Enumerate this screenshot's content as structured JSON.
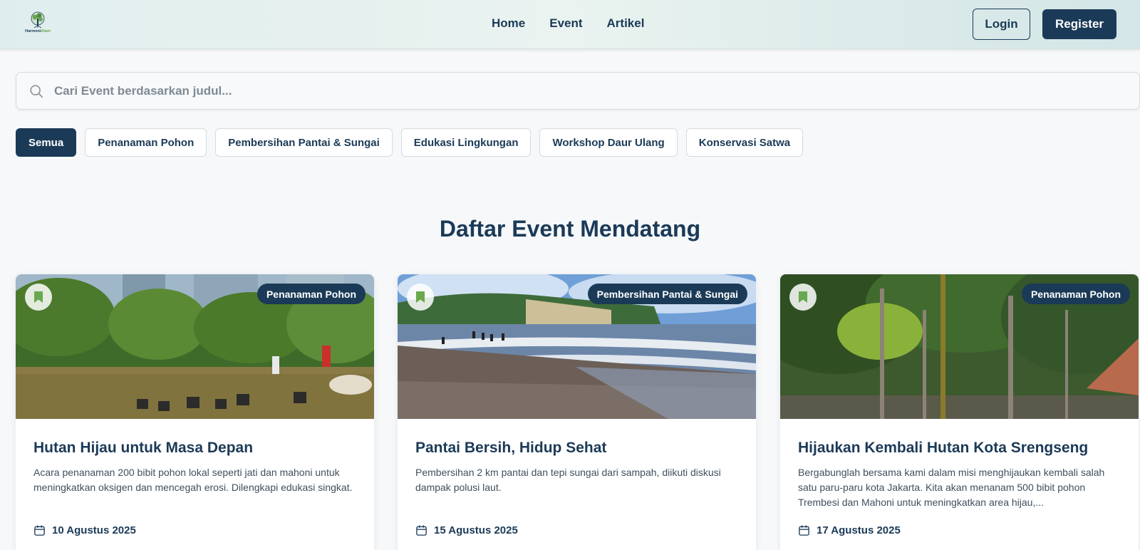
{
  "header": {
    "logo_text_main": "Harmoni",
    "logo_text_accent": "Alam",
    "nav": [
      "Home",
      "Event",
      "Artikel"
    ],
    "login_label": "Login",
    "register_label": "Register"
  },
  "search": {
    "placeholder": "Cari Event berdasarkan judul..."
  },
  "filters": [
    {
      "label": "Semua",
      "active": true
    },
    {
      "label": "Penanaman Pohon",
      "active": false
    },
    {
      "label": "Pembersihan Pantai & Sungai",
      "active": false
    },
    {
      "label": "Edukasi Lingkungan",
      "active": false
    },
    {
      "label": "Workshop Daur Ulang",
      "active": false
    },
    {
      "label": "Konservasi Satwa",
      "active": false
    }
  ],
  "section_title": "Daftar Event Mendatang",
  "events": [
    {
      "category": "Penanaman Pohon",
      "title": "Hutan Hijau untuk Masa Depan",
      "description": "Acara penanaman 200 bibit pohon lokal seperti jati dan mahoni untuk meningkatkan oksigen dan mencegah erosi. Dilengkapi edukasi singkat.",
      "date": "10 Agustus 2025",
      "image_icon": "tree-planting-photo"
    },
    {
      "category": "Pembersihan Pantai & Sungai",
      "title": "Pantai Bersih, Hidup Sehat",
      "description": "Pembersihan 2 km pantai dan tepi sungai dari sampah, diikuti diskusi dampak polusi laut.",
      "date": "15 Agustus 2025",
      "image_icon": "beach-photo"
    },
    {
      "category": "Penanaman Pohon",
      "title": "Hijaukan Kembali Hutan Kota Srengseng",
      "description": "Bergabunglah bersama kami dalam misi menghijaukan kembali salah satu paru-paru kota Jakarta. Kita akan menanam 500 bibit pohon Trembesi dan Mahoni untuk meningkatkan area hijau,...",
      "date": "17 Agustus 2025",
      "image_icon": "urban-forest-photo"
    }
  ],
  "colors": {
    "primary": "#1b3a57",
    "accent_green": "#6aa84f",
    "background": "#f6f8fa"
  }
}
